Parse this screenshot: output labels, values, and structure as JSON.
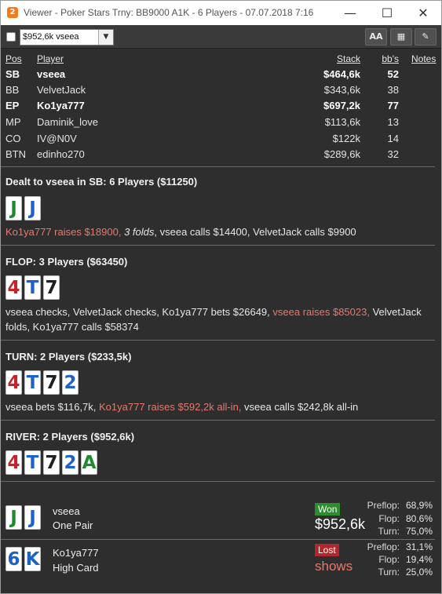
{
  "window": {
    "app_icon": "2",
    "title": "Viewer - Poker Stars Trny: BB9000 A1K - 6 Players - 07.07.2018 7:16",
    "min_glyph": "—",
    "max_glyph": "☐",
    "close_glyph": "✕"
  },
  "toolbar": {
    "hand_select_value": "$952,6k vseea",
    "font_button_label": "AA",
    "grid_button_label": "▦",
    "edit_button_label": "✎"
  },
  "players_table": {
    "headers": {
      "pos": "Pos",
      "player": "Player",
      "stack": "Stack",
      "bbs": "bb's",
      "notes": "Notes"
    },
    "rows": [
      {
        "pos": "SB",
        "name": "vseea",
        "stack": "$464,6k",
        "bbs": "52",
        "bold": true
      },
      {
        "pos": "BB",
        "name": "VelvetJack",
        "stack": "$343,6k",
        "bbs": "38",
        "bold": false
      },
      {
        "pos": "EP",
        "name": "Ko1ya777",
        "stack": "$697,2k",
        "bbs": "77",
        "bold": true
      },
      {
        "pos": "MP",
        "name": "Daminik_love",
        "stack": "$113,6k",
        "bbs": "13",
        "bold": false
      },
      {
        "pos": "CO",
        "name": "IV@N0V",
        "stack": "$122k",
        "bbs": "14",
        "bold": false
      },
      {
        "pos": "BTN",
        "name": "edinho270",
        "stack": "$289,6k",
        "bbs": "32",
        "bold": false
      }
    ]
  },
  "preflop": {
    "title": "Dealt to vseea in SB: 6 Players ($11250)",
    "cards": [
      {
        "rank": "J",
        "suit": "clubs"
      },
      {
        "rank": "J",
        "suit": "diamonds"
      }
    ],
    "actions": {
      "a1": "Ko1ya777 raises $18900,",
      "a2": "3 folds",
      "a3": ", vseea calls $14400, VelvetJack calls $9900"
    }
  },
  "flop": {
    "title": "FLOP: 3 Players ($63450)",
    "cards": [
      {
        "rank": "4",
        "suit": "hearts"
      },
      {
        "rank": "T",
        "suit": "diamonds"
      },
      {
        "rank": "7",
        "suit": "spades"
      }
    ],
    "actions": {
      "a1": "vseea checks, VelvetJack checks, Ko1ya777 bets $26649, ",
      "a2": "vseea raises $85023,",
      "a3": " VelvetJack folds, Ko1ya777 calls $58374"
    }
  },
  "turn": {
    "title": "TURN: 2 Players ($233,5k)",
    "cards": [
      {
        "rank": "4",
        "suit": "hearts"
      },
      {
        "rank": "T",
        "suit": "diamonds"
      },
      {
        "rank": "7",
        "suit": "spades"
      },
      {
        "rank": "2",
        "suit": "diamonds"
      }
    ],
    "actions": {
      "a1": "vseea bets $116,7k, ",
      "a2": "Ko1ya777 raises $592,2k all-in,",
      "a3": " vseea calls $242,8k all-in"
    }
  },
  "river": {
    "title": "RIVER: 2 Players ($952,6k)",
    "cards": [
      {
        "rank": "4",
        "suit": "hearts"
      },
      {
        "rank": "T",
        "suit": "diamonds"
      },
      {
        "rank": "7",
        "suit": "spades"
      },
      {
        "rank": "2",
        "suit": "diamonds"
      },
      {
        "rank": "A",
        "suit": "clubs"
      }
    ]
  },
  "summary": {
    "winner": {
      "name": "vseea",
      "hand": "One Pair",
      "cards": [
        {
          "rank": "J",
          "suit": "clubs"
        },
        {
          "rank": "J",
          "suit": "diamonds"
        }
      ],
      "result": "Won",
      "amount": "$952,6k",
      "preflop_label": "Preflop:",
      "preflop": "68,9%",
      "flop_label": "Flop:",
      "flop": "80,6%",
      "turn_label": "Turn:",
      "turn": "75,0%"
    },
    "loser": {
      "name": "Ko1ya777",
      "hand": "High Card",
      "cards": [
        {
          "rank": "6",
          "suit": "diamonds"
        },
        {
          "rank": "K",
          "suit": "diamonds"
        }
      ],
      "result": "Lost",
      "amount": "shows",
      "preflop_label": "Preflop:",
      "preflop": "31,1%",
      "flop_label": "Flop:",
      "flop": "19,4%",
      "turn_label": "Turn:",
      "turn": "25,0%"
    }
  },
  "colors": {
    "background": "#2e2e2e",
    "highlight_red": "#e8786c",
    "hearts": "#c8232b",
    "diamonds": "#1d63c7",
    "clubs": "#1f8a2e",
    "spades": "#202020",
    "won_badge": "#2c8e2c",
    "lost_badge": "#b3272c"
  }
}
